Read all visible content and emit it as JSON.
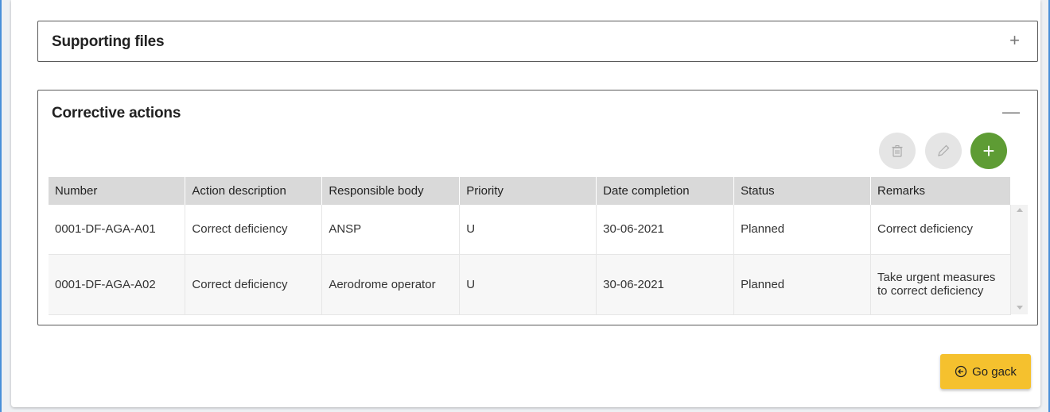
{
  "supporting": {
    "title": "Supporting files",
    "toggle": "+"
  },
  "corrective": {
    "title": "Corrective actions",
    "toggle": "—",
    "add_symbol": "+",
    "columns": [
      "Number",
      "Action description",
      "Responsible body",
      "Priority",
      "Date completion",
      "Status",
      "Remarks"
    ],
    "rows": [
      [
        "0001-DF-AGA-A01",
        "Correct deficiency",
        "ANSP",
        "U",
        "30-06-2021",
        "Planned",
        "Correct deficiency"
      ],
      [
        "0001-DF-AGA-A02",
        "Correct deficiency",
        "Aerodrome operator",
        "U",
        "30-06-2021",
        "Planned",
        "Take urgent measures to correct deficiency"
      ]
    ]
  },
  "actions": {
    "go_back_label": "Go gack"
  },
  "icons": {
    "delete": "trash-icon",
    "edit": "pencil-icon",
    "add": "plus-icon",
    "back": "circle-arrow-left-icon"
  },
  "colors": {
    "add_button": "#5e9c34",
    "go_back_button": "#f5c12e",
    "frame_border": "#4a90d9"
  }
}
